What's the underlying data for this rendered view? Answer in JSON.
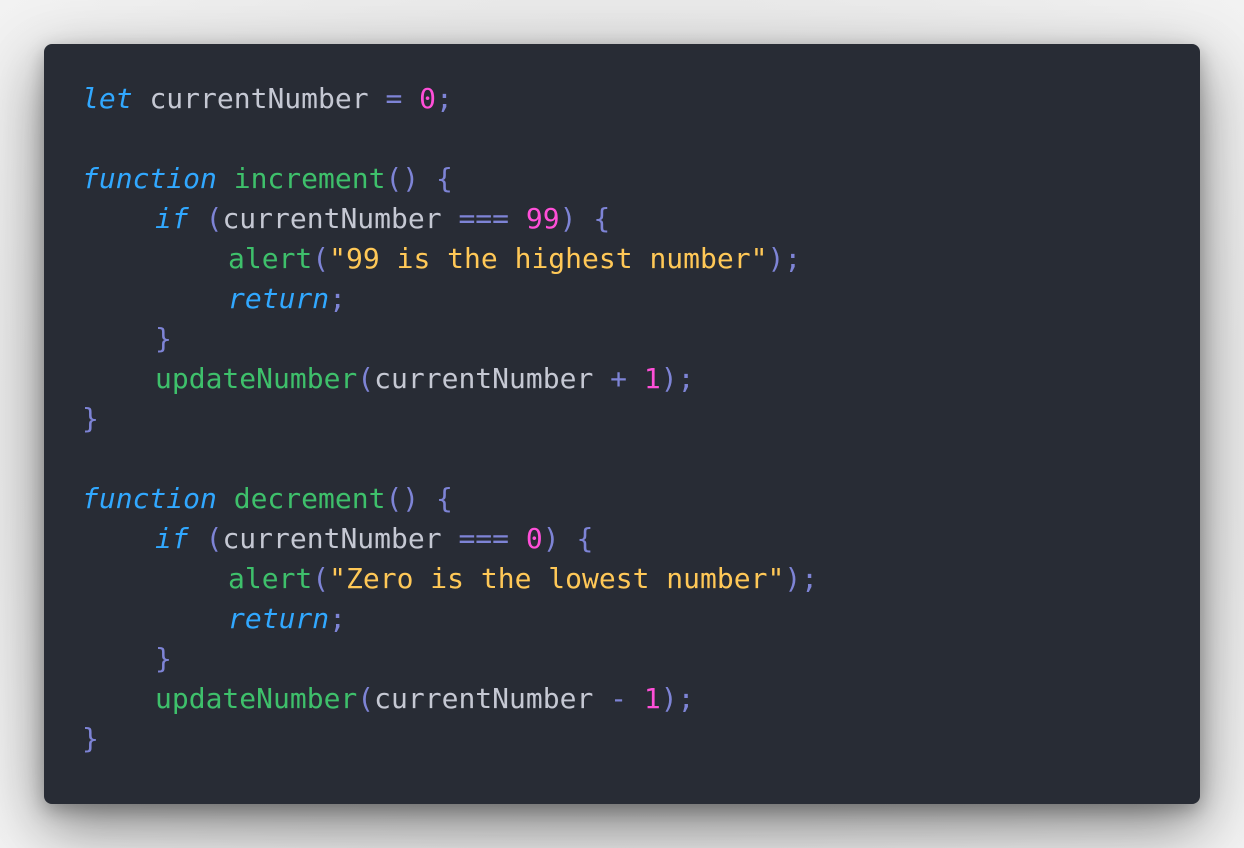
{
  "colors": {
    "background": "#e4e4e4",
    "editor": "#282c35",
    "keyword": "#31a8ff",
    "function": "#3ec06b",
    "number": "#ff4fd8",
    "string": "#ffc857",
    "punctuation": "#7e84d6",
    "identifier": "#c5c8d3"
  },
  "code": {
    "l1": {
      "kw": "let",
      "var": "currentNumber",
      "op": "=",
      "num": "0",
      "end": ";"
    },
    "l3": {
      "kw": "function",
      "fn": "increment",
      "paren": "()",
      "brace": "{"
    },
    "l4": {
      "kw": "if",
      "open": "(",
      "var": "currentNumber",
      "op": "===",
      "num": "99",
      "close": ")",
      "brace": "{"
    },
    "l5": {
      "fn": "alert",
      "open": "(",
      "str": "\"99 is the highest number\"",
      "close": ")",
      "end": ";"
    },
    "l6": {
      "kw": "return",
      "end": ";"
    },
    "l7": {
      "brace": "}"
    },
    "l8": {
      "fn": "updateNumber",
      "open": "(",
      "var": "currentNumber",
      "op": "+",
      "num": "1",
      "close": ")",
      "end": ";"
    },
    "l9": {
      "brace": "}"
    },
    "l11": {
      "kw": "function",
      "fn": "decrement",
      "paren": "()",
      "brace": "{"
    },
    "l12": {
      "kw": "if",
      "open": "(",
      "var": "currentNumber",
      "op": "===",
      "num": "0",
      "close": ")",
      "brace": "{"
    },
    "l13": {
      "fn": "alert",
      "open": "(",
      "str": "\"Zero is the lowest number\"",
      "close": ")",
      "end": ";"
    },
    "l14": {
      "kw": "return",
      "end": ";"
    },
    "l15": {
      "brace": "}"
    },
    "l16": {
      "fn": "updateNumber",
      "open": "(",
      "var": "currentNumber",
      "op": "-",
      "num": "1",
      "close": ")",
      "end": ";"
    },
    "l17": {
      "brace": "}"
    }
  }
}
